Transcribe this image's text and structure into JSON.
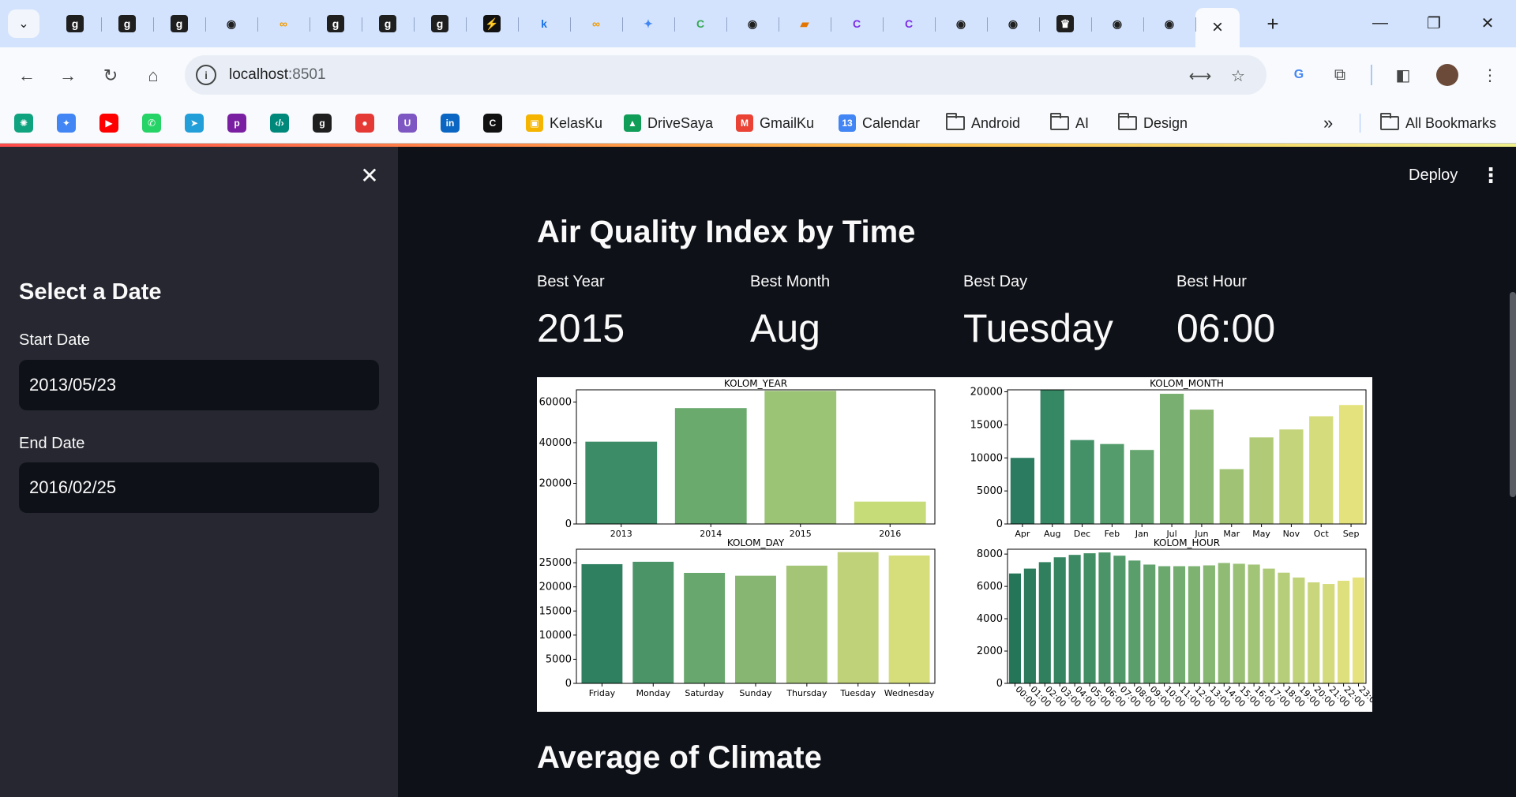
{
  "browser": {
    "tabs": [
      {
        "icon": "g-icon",
        "color": "#1f1f1f",
        "glyph": "g"
      },
      {
        "icon": "g-icon",
        "color": "#1f1f1f",
        "glyph": "g"
      },
      {
        "icon": "g-icon",
        "color": "#1f1f1f",
        "glyph": "g"
      },
      {
        "icon": "github-icon",
        "color": "#1f1f1f",
        "glyph": "◉"
      },
      {
        "icon": "infinity-icon",
        "color": "#f29900",
        "glyph": "∞"
      },
      {
        "icon": "g-icon",
        "color": "#1f1f1f",
        "glyph": "g"
      },
      {
        "icon": "g-icon",
        "color": "#1f1f1f",
        "glyph": "g"
      },
      {
        "icon": "g-icon",
        "color": "#1f1f1f",
        "glyph": "g"
      },
      {
        "icon": "bolt-icon",
        "color": "#111111",
        "glyph": "⚡"
      },
      {
        "icon": "k-icon",
        "color": "#1a73e8",
        "glyph": "k"
      },
      {
        "icon": "infinity-icon",
        "color": "#f29900",
        "glyph": "∞"
      },
      {
        "icon": "gemini-icon",
        "color": "#4285f4",
        "glyph": "✦"
      },
      {
        "icon": "c-swirl-icon",
        "color": "#34a853",
        "glyph": "C"
      },
      {
        "icon": "github-icon",
        "color": "#1f1f1f",
        "glyph": "◉"
      },
      {
        "icon": "book-icon",
        "color": "#e37400",
        "glyph": "▰"
      },
      {
        "icon": "canva-icon",
        "color": "#7d2ae8",
        "glyph": "C"
      },
      {
        "icon": "canva-icon",
        "color": "#7d2ae8",
        "glyph": "C"
      },
      {
        "icon": "github-icon",
        "color": "#1f1f1f",
        "glyph": "◉"
      },
      {
        "icon": "github-icon",
        "color": "#1f1f1f",
        "glyph": "◉"
      },
      {
        "icon": "crown-icon",
        "color": "#1f1f1f",
        "glyph": "♛"
      },
      {
        "icon": "github-icon",
        "color": "#1f1f1f",
        "glyph": "◉"
      },
      {
        "icon": "github-icon",
        "color": "#1f1f1f",
        "glyph": "◉"
      }
    ],
    "active_tab_close": "×",
    "new_tab": "+",
    "url_host": "localhost",
    "url_port": ":8501",
    "bookmarks": [
      {
        "label": "KelasKu",
        "color": "#f4b400",
        "glyph": "▣"
      },
      {
        "label": "DriveSaya",
        "color": "#0f9d58",
        "glyph": "▲"
      },
      {
        "label": "GmailKu",
        "color": "#ea4335",
        "glyph": "M"
      },
      {
        "label": "Calendar",
        "color": "#4285f4",
        "glyph": "13"
      },
      {
        "label": "Android",
        "folder": true
      },
      {
        "label": "AI",
        "folder": true
      },
      {
        "label": "Design",
        "folder": true
      }
    ],
    "bookmark_icons": [
      {
        "name": "chatgpt-icon",
        "color": "#10a37f",
        "glyph": "✺"
      },
      {
        "name": "gemini-icon",
        "color": "#4285f4",
        "glyph": "✦"
      },
      {
        "name": "youtube-icon",
        "color": "#ff0000",
        "glyph": "▶"
      },
      {
        "name": "whatsapp-icon",
        "color": "#25d366",
        "glyph": "✆"
      },
      {
        "name": "telegram-icon",
        "color": "#229ed9",
        "glyph": "➤"
      },
      {
        "name": "p-icon",
        "color": "#7b1fa2",
        "glyph": "p"
      },
      {
        "name": "code-icon",
        "color": "#00897b",
        "glyph": "‹/›"
      },
      {
        "name": "g-icon",
        "color": "#1f1f1f",
        "glyph": "g"
      },
      {
        "name": "superset-icon",
        "color": "#e53935",
        "glyph": "●"
      },
      {
        "name": "u-icon",
        "color": "#7e57c2",
        "glyph": "U"
      },
      {
        "name": "linkedin-icon",
        "color": "#0a66c2",
        "glyph": "in"
      },
      {
        "name": "c-box-icon",
        "color": "#111111",
        "glyph": "C"
      }
    ],
    "more_bookmarks": "»",
    "all_bookmarks": "All Bookmarks"
  },
  "sidebar": {
    "title": "Select a Date",
    "start_label": "Start Date",
    "start_value": "2013/05/23",
    "end_label": "End Date",
    "end_value": "2016/02/25"
  },
  "header": {
    "deploy": "Deploy"
  },
  "main": {
    "title": "Air Quality Index by Time",
    "metrics": [
      {
        "label": "Best Year",
        "value": "2015"
      },
      {
        "label": "Best Month",
        "value": "Aug"
      },
      {
        "label": "Best Day",
        "value": "Tuesday"
      },
      {
        "label": "Best Hour",
        "value": "06:00"
      }
    ],
    "section2_title": "Average of Climate"
  },
  "chart_data": [
    {
      "type": "bar",
      "title": "KOLOM_YEAR",
      "categories": [
        "2013",
        "2014",
        "2015",
        "2016"
      ],
      "values": [
        40500,
        57000,
        65500,
        11000
      ],
      "ylim": [
        0,
        66000
      ],
      "yticks": [
        0,
        20000,
        40000,
        60000
      ],
      "colors": [
        "#3d8c68",
        "#6aaa6d",
        "#9bc474",
        "#c6dc78"
      ]
    },
    {
      "type": "bar",
      "title": "KOLOM_MONTH",
      "categories": [
        "Apr",
        "Aug",
        "Dec",
        "Feb",
        "Jan",
        "Jul",
        "Jun",
        "Mar",
        "May",
        "Nov",
        "Oct",
        "Sep"
      ],
      "values": [
        10000,
        20300,
        12700,
        12100,
        11200,
        19700,
        17300,
        8300,
        13100,
        14300,
        16300,
        18000
      ],
      "ylim": [
        0,
        20300
      ],
      "yticks": [
        0,
        5000,
        10000,
        15000,
        20000
      ],
      "colors": [
        "#2a7b5f",
        "#368763",
        "#449168",
        "#559c6c",
        "#66a56f",
        "#79b071",
        "#8bb873",
        "#9fc275",
        "#b1ca77",
        "#c4d47a",
        "#d5dc7c",
        "#e3e27d"
      ]
    },
    {
      "type": "bar",
      "title": "KOLOM_DAY",
      "categories": [
        "Friday",
        "Monday",
        "Saturday",
        "Sunday",
        "Thursday",
        "Tuesday",
        "Wednesday"
      ],
      "values": [
        24700,
        25200,
        22900,
        22300,
        24400,
        27200,
        26500
      ],
      "ylim": [
        0,
        27800
      ],
      "yticks": [
        0,
        5000,
        10000,
        15000,
        20000,
        25000
      ],
      "colors": [
        "#2f7f61",
        "#4a9468",
        "#68a76e",
        "#86b672",
        "#a4c476",
        "#bfd279",
        "#d6de7b"
      ]
    },
    {
      "type": "bar",
      "title": "KOLOM_HOUR",
      "categories": [
        "00:00",
        "01:00",
        "02:00",
        "03:00",
        "04:00",
        "05:00",
        "06:00",
        "07:00",
        "08:00",
        "09:00",
        "10:00",
        "11:00",
        "12:00",
        "13:00",
        "14:00",
        "15:00",
        "16:00",
        "17:00",
        "18:00",
        "19:00",
        "20:00",
        "21:00",
        "22:00",
        "23:00"
      ],
      "values": [
        6800,
        7100,
        7500,
        7800,
        7950,
        8050,
        8100,
        7900,
        7600,
        7350,
        7250,
        7250,
        7250,
        7300,
        7450,
        7400,
        7350,
        7100,
        6850,
        6550,
        6250,
        6150,
        6350,
        6550
      ],
      "ylim": [
        0,
        8300
      ],
      "yticks": [
        0,
        2000,
        4000,
        6000,
        8000
      ],
      "colors": [
        "#257659",
        "#2b7b5c",
        "#30805e",
        "#368561",
        "#3c8a63",
        "#438f65",
        "#4a9467",
        "#529969",
        "#5a9e6b",
        "#62a36d",
        "#6ba86e",
        "#74ad70",
        "#7db271",
        "#86b773",
        "#8fbb74",
        "#99c075",
        "#a2c476",
        "#acc978",
        "#b6cd79",
        "#c0d27a",
        "#cad67b",
        "#d4db7c",
        "#dedf7d",
        "#e6e27e"
      ]
    }
  ]
}
